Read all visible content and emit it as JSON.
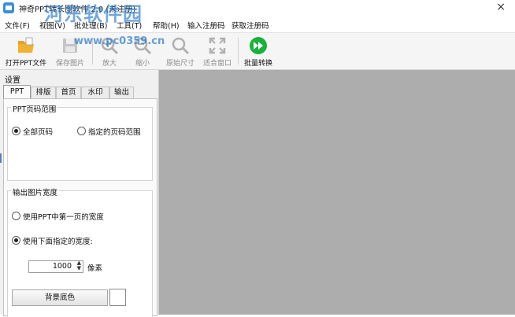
{
  "window": {
    "title": "神奇PPT转长图软件 2.0 (未注册)",
    "close_glyph": "×"
  },
  "watermark": {
    "text": "河东软件园",
    "url": "www.pc0359.cn"
  },
  "menu": [
    {
      "label": "文件(F)"
    },
    {
      "label": "视图(V)"
    },
    {
      "label": "批处理(B)"
    },
    {
      "label": "工具(T)"
    },
    {
      "label": "帮助(H)"
    },
    {
      "label": "输入注册码"
    },
    {
      "label": "获取注册码"
    }
  ],
  "toolbar": {
    "open_ppt": {
      "label": "打开PPT文件",
      "icon": "folder-open-icon",
      "enabled": true
    },
    "save_image": {
      "label": "保存图片",
      "icon": "save-icon",
      "enabled": false
    },
    "zoom_in": {
      "label": "放大",
      "icon": "zoom-in-icon",
      "enabled": false
    },
    "zoom_out": {
      "label": "缩小",
      "icon": "zoom-out-icon",
      "enabled": false
    },
    "original_size": {
      "label": "原始尺寸",
      "icon": "original-size-icon",
      "enabled": false
    },
    "fit_window": {
      "label": "适合窗口",
      "icon": "fit-window-icon",
      "enabled": false
    },
    "batch_convert": {
      "label": "批量转换",
      "icon": "batch-convert-icon",
      "enabled": true
    }
  },
  "settings": {
    "title": "设置",
    "tabs": [
      {
        "label": "PPT",
        "active": true
      },
      {
        "label": "排版",
        "active": false
      },
      {
        "label": "首页",
        "active": false
      },
      {
        "label": "水印",
        "active": false
      },
      {
        "label": "输出",
        "active": false
      }
    ],
    "page_range": {
      "label": "PPT页码范围",
      "options": [
        {
          "label": "全部页码",
          "selected": true
        },
        {
          "label": "指定的页码范围",
          "selected": false
        }
      ]
    },
    "output_width": {
      "label": "输出图片宽度",
      "options": [
        {
          "label": "使用PPT中第一页的宽度",
          "selected": false
        },
        {
          "label": "使用下面指定的宽度:",
          "selected": true
        }
      ],
      "width_value": "1000",
      "unit": "像素"
    },
    "bg_color_button": "背景底色",
    "bg_color": "#ffffff"
  },
  "colors": {
    "canvas": "#adadad",
    "panel": "#f0f0f0",
    "accent_green": "#19b23a",
    "folder_yellow": "#f2b230",
    "disabled_gray": "#9a9a9a",
    "watermark_blue": "#2878c8"
  }
}
